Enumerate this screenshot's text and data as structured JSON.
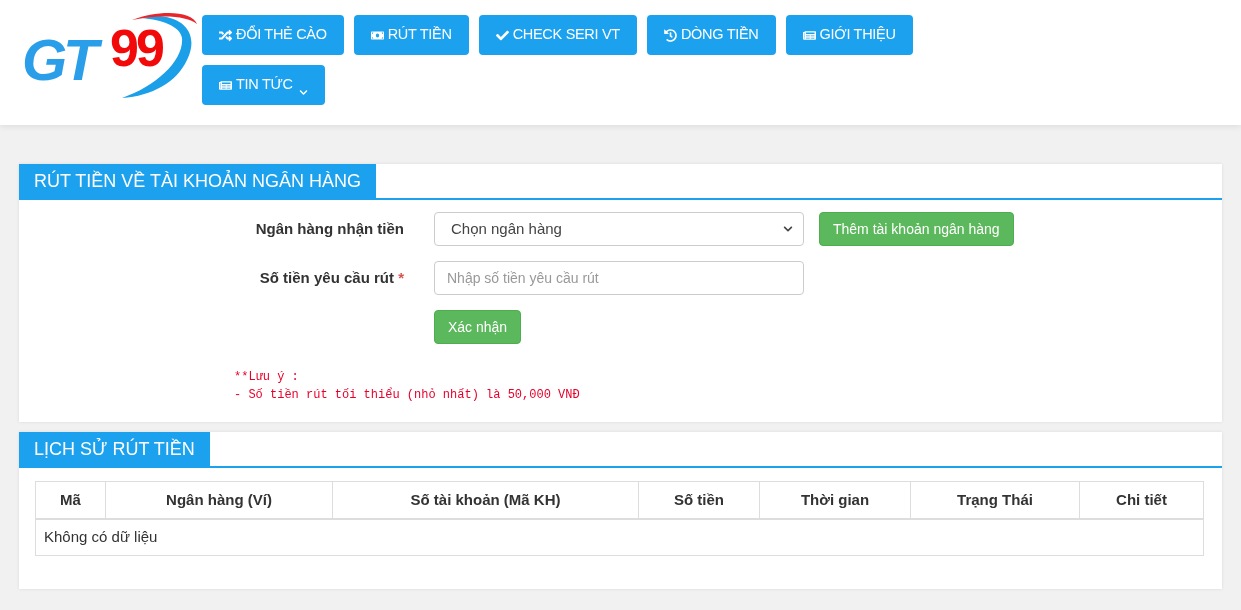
{
  "logo": {
    "letters": "GT",
    "digits": "99"
  },
  "nav": [
    {
      "label": "ĐỔI THẺ CÀO",
      "dropdown": false
    },
    {
      "label": "RÚT TIỀN",
      "dropdown": false
    },
    {
      "label": "CHECK SERI VT",
      "dropdown": false
    },
    {
      "label": "DÒNG TIỀN",
      "dropdown": false
    },
    {
      "label": "GIỚI THIỆU",
      "dropdown": false
    },
    {
      "label": "TIN TỨC",
      "dropdown": true
    }
  ],
  "withdraw": {
    "title": "RÚT TIỀN VỀ TÀI KHOẢN NGÂN HÀNG",
    "bank_label": "Ngân hàng nhận tiền",
    "bank_select": "Chọn ngân hàng",
    "add_bank_button": "Thêm tài khoản ngân hàng",
    "amount_label": "Số tiền yêu cầu rút",
    "required_mark": "*",
    "amount_placeholder": "Nhập số tiền yêu cầu rút",
    "submit_button": "Xác nhận",
    "notes": [
      "**Lưu ý :",
      "- Số tiền rút tối thiểu (nhỏ nhất) là 50,000 VNĐ"
    ]
  },
  "history": {
    "title": "LỊCH SỬ RÚT TIỀN",
    "columns": [
      "Mã",
      "Ngân hàng (Ví)",
      "Số tài khoản (Mã KH)",
      "Số tiền",
      "Thời gian",
      "Trạng Thái",
      "Chi tiết"
    ],
    "empty_message": "Không có dữ liệu"
  }
}
